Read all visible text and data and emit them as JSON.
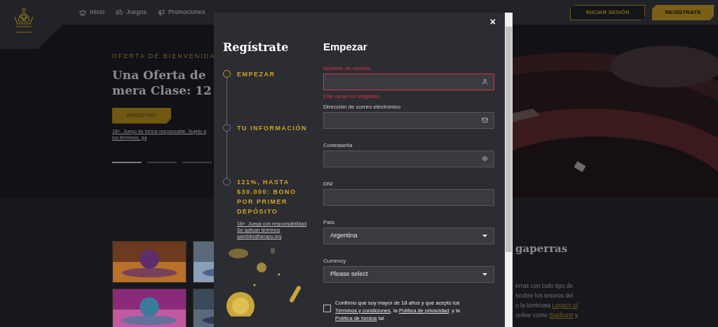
{
  "header": {
    "nav": [
      {
        "label": "Inicio"
      },
      {
        "label": "Juegos"
      },
      {
        "label": "Promociones"
      }
    ],
    "login_button": "INICIAR SESIÓN",
    "register_button": "REGÍSTRATE"
  },
  "hero": {
    "eyebrow": "OFERTA DE BIENVENIDA",
    "title_lines": [
      "Una Oferta de",
      "mera Clase: 12"
    ],
    "button": "REGISTRO",
    "fine_print": "18+. Juego de forma responsable. Sujeto a los términos, ga",
    "slides": [
      {
        "selected": true
      },
      {
        "selected": false
      },
      {
        "selected": false
      }
    ]
  },
  "games": {
    "heading": "gaperras",
    "paragraph": [
      {
        "text": "erras con todo tipo de"
      },
      {
        "text": "scubre los tesoros del"
      },
      {
        "text": "o la luminosa ",
        "link": "Legacy of"
      },
      {
        "text": "online como ",
        "link": "Starburst",
        "after": " y"
      }
    ]
  },
  "modal": {
    "title": "Regístrate",
    "close": "×",
    "steps": [
      {
        "label": "EMPEZAR",
        "selected": true
      },
      {
        "label": "TU INFORMACIÓN",
        "selected": false
      },
      {
        "label": "121%, HASTA $30.000: BONO POR PRIMER DEPÓSITO",
        "selected": false
      }
    ],
    "fine_print": [
      {
        "text": "18+. Juega con responsabilidad"
      },
      {
        "text": "Se aplican términos"
      },
      {
        "text": "gamblingtherapy.org"
      }
    ],
    "form_title": "Empezar",
    "fields": [
      {
        "kind": "text",
        "label": "Nombre de usuario",
        "invalid": true,
        "error_message": "Este campo es obligatorio"
      },
      {
        "kind": "text",
        "label": "Dirección de correo electrónico",
        "invalid": false
      },
      {
        "kind": "text",
        "label": "Contraseña",
        "invalid": false
      },
      {
        "kind": "text",
        "label": "DNI",
        "invalid": false
      },
      {
        "kind": "select",
        "label": "País",
        "value": "Argentina",
        "invalid": false
      },
      {
        "kind": "select",
        "label": "Currency",
        "value": "Please select",
        "invalid": false
      }
    ],
    "consent": {
      "checked": false,
      "parts": [
        {
          "text": "Confirmo que soy mayor de 18 años y que acepto los "
        },
        {
          "text": "Términos y condiciones",
          "link": true
        },
        {
          "text": ", la "
        },
        {
          "text": "Política de privacidad",
          "link": true
        },
        {
          "text": ", y la "
        },
        {
          "text": "Política de fondos",
          "link": true
        },
        {
          "text": " tal"
        }
      ]
    }
  }
}
